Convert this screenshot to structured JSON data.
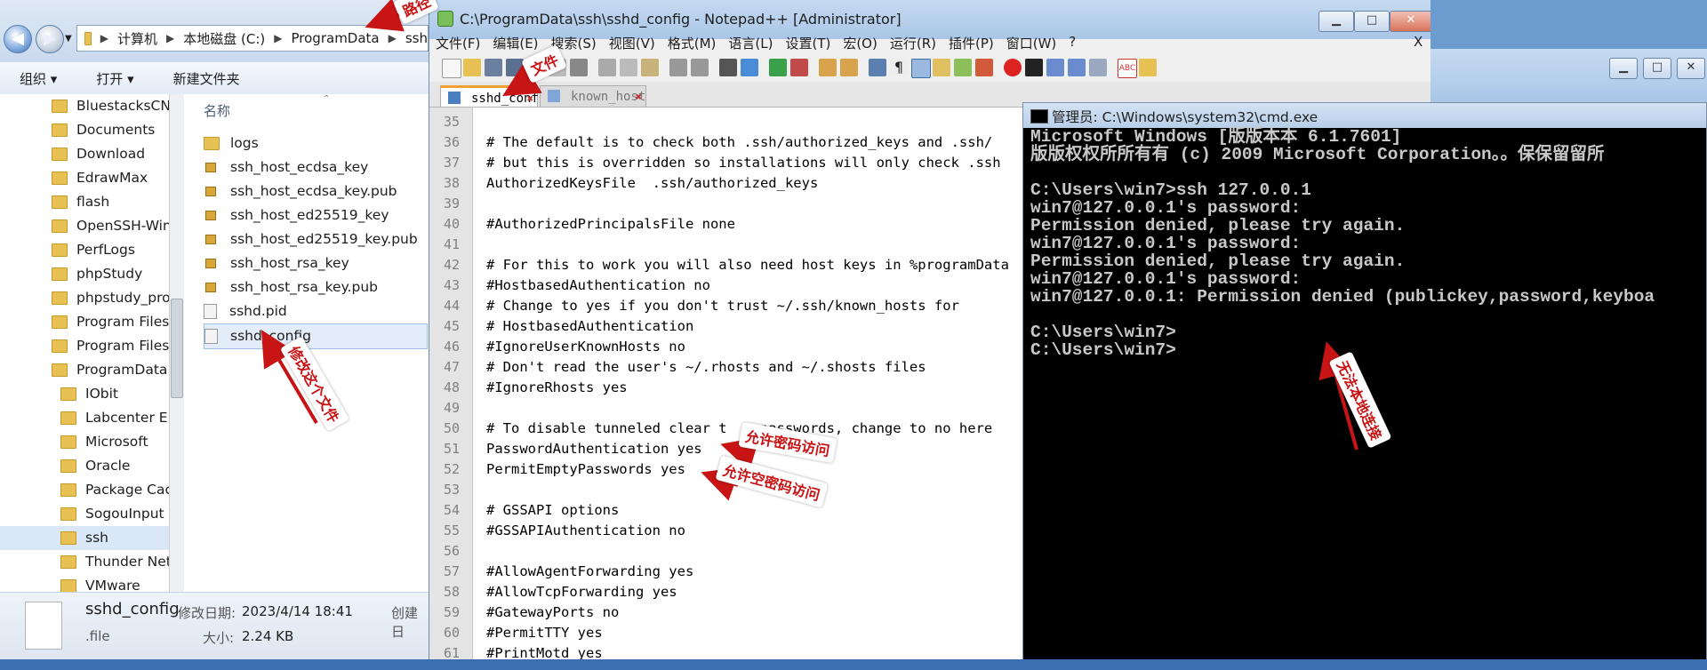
{
  "explorer": {
    "breadcrumb": [
      "计算机",
      "本地磁盘 (C:)",
      "ProgramData",
      "ssh"
    ],
    "toolbar": {
      "organize": "组织 ▾",
      "open": "打开 ▾",
      "new_folder": "新建文件夹"
    },
    "tree_items": [
      "BluestacksCN",
      "Documents",
      "Download",
      "EdrawMax",
      "flash",
      "OpenSSH-Win",
      "PerfLogs",
      "phpStudy",
      "phpstudy_pro",
      "Program Files",
      "Program Files (",
      "ProgramData",
      "IObit",
      "Labcenter Ele",
      "Microsoft",
      "Oracle",
      "Package Cach",
      "SogouInput",
      "ssh",
      "Thunder Netw",
      "VMware"
    ],
    "column_header": "名称",
    "files": [
      "logs",
      "ssh_host_ecdsa_key",
      "ssh_host_ecdsa_key.pub",
      "ssh_host_ed25519_key",
      "ssh_host_ed25519_key.pub",
      "ssh_host_rsa_key",
      "ssh_host_rsa_key.pub",
      "sshd.pid",
      "sshd_config"
    ],
    "status": {
      "name": "sshd_config",
      "type": ".file",
      "modified_label": "修改日期:",
      "modified": "2023/4/14 18:41",
      "size_label": "大小:",
      "size": "2.24 KB",
      "created_label": "创建日"
    }
  },
  "notepad": {
    "title": "C:\\ProgramData\\ssh\\sshd_config - Notepad++ [Administrator]",
    "menu": [
      "文件(F)",
      "编辑(E)",
      "搜索(S)",
      "视图(V)",
      "格式(M)",
      "语言(L)",
      "设置(T)",
      "宏(O)",
      "运行(R)",
      "插件(P)",
      "窗口(W)",
      "?"
    ],
    "menu_close": "X",
    "tabs": [
      "sshd_confi",
      "known_host"
    ],
    "lines": [
      {
        "n": "35",
        "text": ""
      },
      {
        "n": "36",
        "text": "# The default is to check both .ssh/authorized_keys and .ssh/"
      },
      {
        "n": "37",
        "text": "# but this is overridden so installations will only check .ssh"
      },
      {
        "n": "38",
        "text": "AuthorizedKeysFile  .ssh/authorized_keys"
      },
      {
        "n": "39",
        "text": ""
      },
      {
        "n": "40",
        "text": "#AuthorizedPrincipalsFile none"
      },
      {
        "n": "41",
        "text": ""
      },
      {
        "n": "42",
        "text": "# For this to work you will also need host keys in %programData"
      },
      {
        "n": "43",
        "text": "#HostbasedAuthentication no"
      },
      {
        "n": "44",
        "text": "# Change to yes if you don't trust ~/.ssh/known_hosts for"
      },
      {
        "n": "45",
        "text": "# HostbasedAuthentication"
      },
      {
        "n": "46",
        "text": "#IgnoreUserKnownHosts no"
      },
      {
        "n": "47",
        "text": "# Don't read the user's ~/.rhosts and ~/.shosts files"
      },
      {
        "n": "48",
        "text": "#IgnoreRhosts yes"
      },
      {
        "n": "49",
        "text": ""
      },
      {
        "n": "50",
        "text": "# To disable tunneled clear t    passwords, change to no here"
      },
      {
        "n": "51",
        "text": "PasswordAuthentication yes"
      },
      {
        "n": "52",
        "text": "PermitEmptyPasswords yes"
      },
      {
        "n": "53",
        "text": ""
      },
      {
        "n": "54",
        "text": "# GSSAPI options"
      },
      {
        "n": "55",
        "text": "#GSSAPIAuthentication no"
      },
      {
        "n": "56",
        "text": ""
      },
      {
        "n": "57",
        "text": "#AllowAgentForwarding yes"
      },
      {
        "n": "58",
        "text": "#AllowTcpForwarding yes"
      },
      {
        "n": "59",
        "text": "#GatewayPorts no"
      },
      {
        "n": "60",
        "text": "#PermitTTY yes"
      },
      {
        "n": "61",
        "text": "#PrintMotd yes"
      }
    ]
  },
  "cmd": {
    "title": "管理员: C:\\Windows\\system32\\cmd.exe",
    "lines": [
      "Microsoft Windows [版版本本 6.1.7601]",
      "版版权权所所有有 (c) 2009 Microsoft Corporation。。保保留留所",
      "",
      "C:\\Users\\win7>ssh 127.0.0.1",
      "win7@127.0.0.1's password:",
      "Permission denied, please try again.",
      "win7@127.0.0.1's password:",
      "Permission denied, please try again.",
      "win7@127.0.0.1's password:",
      "win7@127.0.0.1: Permission denied (publickey,password,keyboa",
      "",
      "C:\\Users\\win7>",
      "C:\\Users\\win7>"
    ]
  },
  "annotations": {
    "path": "路径",
    "file": "文件",
    "modify": "修改这个文件",
    "allow_password": "允许密码访问",
    "allow_empty": "允许空密码访问",
    "local_fail": "无法本地连接"
  },
  "colors": {
    "annotation": "#c81414",
    "cmd_bg": "#000000",
    "cmd_text": "#c8c8c8",
    "selection": "#d9e7f7"
  }
}
